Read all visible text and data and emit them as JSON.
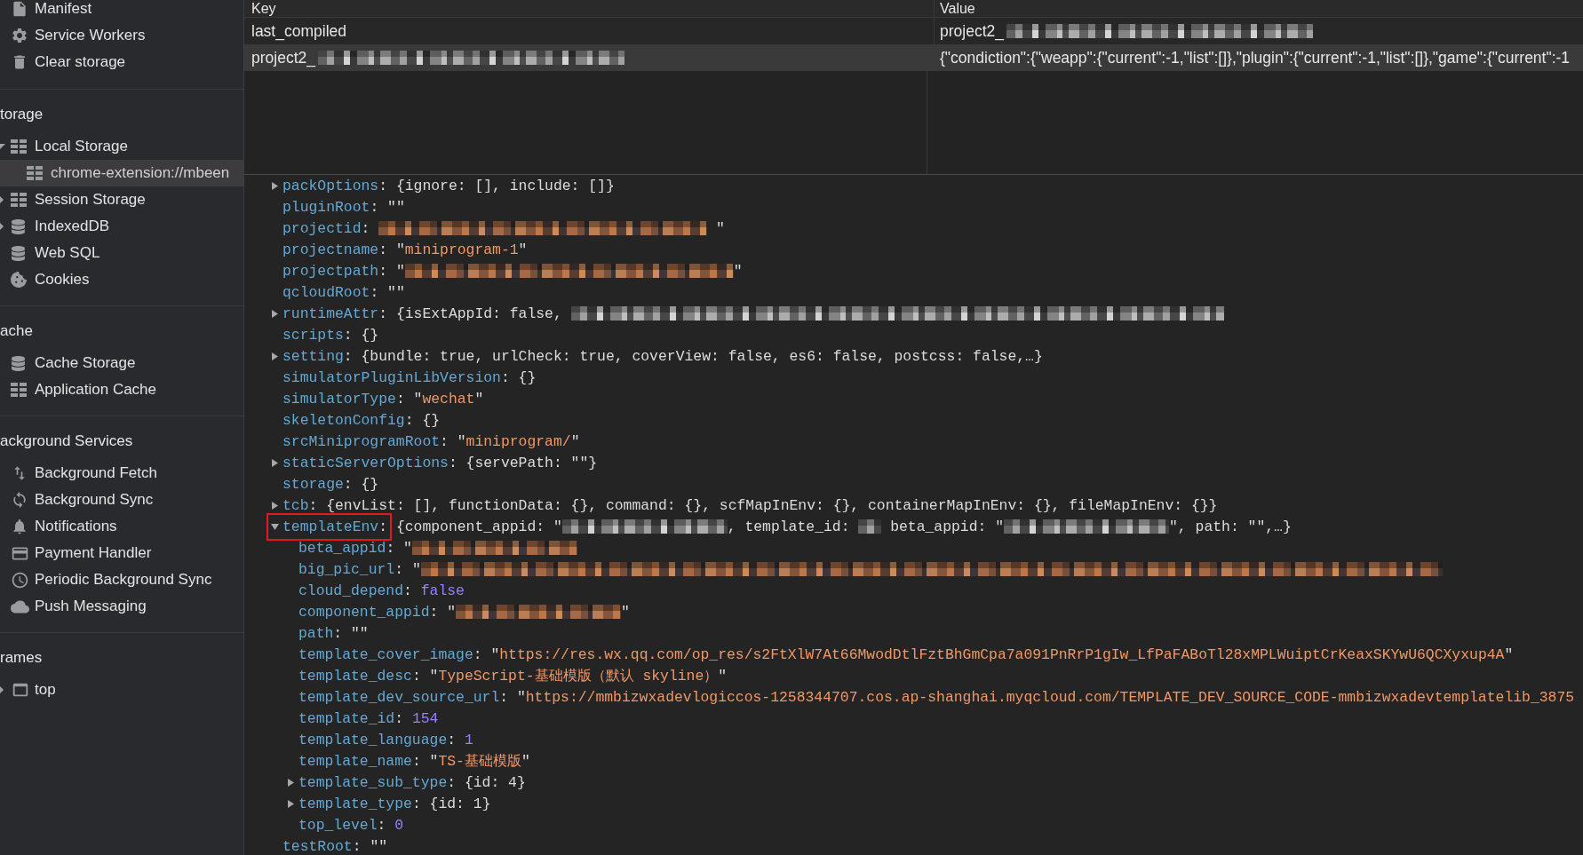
{
  "sidebar": {
    "sections": [
      {
        "items": [
          {
            "label": "Manifest",
            "kind": "file",
            "selected": false
          },
          {
            "label": "Service Workers",
            "kind": "worker",
            "selected": false
          },
          {
            "label": "Clear storage",
            "kind": "clear",
            "selected": false
          }
        ]
      },
      {
        "title": "torage",
        "items": [
          {
            "label": "Local Storage",
            "kind": "key-value",
            "selected": false,
            "expanded": true,
            "children": [
              {
                "label": "chrome-extension://mbeen",
                "kind": "key-value",
                "selected": true
              }
            ]
          },
          {
            "label": "Session Storage",
            "kind": "key-value",
            "selected": false,
            "expanded": false
          },
          {
            "label": "IndexedDB",
            "kind": "database",
            "selected": false,
            "expanded": false
          },
          {
            "label": "Web SQL",
            "kind": "database",
            "selected": false
          },
          {
            "label": "Cookies",
            "kind": "cookies",
            "selected": false
          }
        ]
      },
      {
        "title": "ache",
        "items": [
          {
            "label": "Cache Storage",
            "kind": "database",
            "selected": false
          },
          {
            "label": "Application Cache",
            "kind": "key-value",
            "selected": false
          }
        ]
      },
      {
        "title": "ackground Services",
        "items": [
          {
            "label": "Background Fetch",
            "kind": "fetch",
            "selected": false
          },
          {
            "label": "Background Sync",
            "kind": "sync",
            "selected": false
          },
          {
            "label": "Notifications",
            "kind": "notifications",
            "selected": false
          },
          {
            "label": "Payment Handler",
            "kind": "payment",
            "selected": false
          },
          {
            "label": "Periodic Background Sync",
            "kind": "periodic-sync",
            "selected": false
          },
          {
            "label": "Push Messaging",
            "kind": "push",
            "selected": false
          }
        ]
      },
      {
        "title": "rames",
        "items": [
          {
            "label": "top",
            "kind": "frame",
            "selected": false,
            "expanded": false
          }
        ]
      }
    ]
  },
  "storage_table": {
    "columns": [
      "Key",
      "Value"
    ],
    "rows": [
      {
        "selected": false,
        "key": [
          {
            "kind": "text",
            "text": "last_compiled"
          }
        ],
        "value": [
          {
            "kind": "text",
            "text": "project2_"
          },
          {
            "kind": "plain-mosaic-medium"
          }
        ]
      },
      {
        "selected": true,
        "key": [
          {
            "kind": "text",
            "text": "project2_"
          },
          {
            "kind": "plain-mosaic-medium"
          }
        ],
        "value": [
          {
            "kind": "text",
            "text": "{\"condiction\":{\"weapp\":{\"current\":-1,\"list\":[]},\"plugin\":{\"current\":-1,\"list\":[]},\"game\":{\"current\":-1"
          }
        ]
      }
    ]
  },
  "object_preview": {
    "lines": [
      {
        "key": "packOptions",
        "separator": ":",
        "expanded": false,
        "value": [
          {
            "kind": "plain",
            "text": "{ignore: [], include: []}"
          }
        ]
      },
      {
        "key": "pluginRoot",
        "separator": ":",
        "value": [
          {
            "kind": "plain",
            "text": "\"\""
          }
        ]
      },
      {
        "key": "projectid",
        "separator": ":",
        "value": [
          {
            "kind": "string-mosaic-medium"
          },
          {
            "kind": "plain",
            "text": " \""
          }
        ]
      },
      {
        "key": "projectname",
        "separator": ":",
        "value": [
          {
            "kind": "plain",
            "text": "\""
          },
          {
            "kind": "string",
            "text": "miniprogram-1"
          },
          {
            "kind": "plain",
            "text": "\""
          }
        ]
      },
      {
        "key": "projectpath",
        "separator": ":",
        "value": [
          {
            "kind": "plain",
            "text": "\""
          },
          {
            "kind": "string-mosaic-medium"
          },
          {
            "kind": "plain",
            "text": "\""
          }
        ]
      },
      {
        "key": "qcloudRoot",
        "separator": ":",
        "value": [
          {
            "kind": "plain",
            "text": "\"\""
          }
        ]
      },
      {
        "key": "runtimeAttr",
        "separator": ":",
        "expanded": false,
        "value": [
          {
            "kind": "plain",
            "text": "{isExtAppId: false, "
          },
          {
            "kind": "plain-mosaic-long"
          }
        ]
      },
      {
        "key": "scripts",
        "separator": ":",
        "value": [
          {
            "kind": "plain",
            "text": "{}"
          }
        ]
      },
      {
        "key": "setting",
        "separator": ":",
        "expanded": false,
        "value": [
          {
            "kind": "plain",
            "text": "{bundle: true, urlCheck: true, coverView: false, es6: false, postcss: false,…}"
          }
        ]
      },
      {
        "key": "simulatorPluginLibVersion",
        "separator": ":",
        "value": [
          {
            "kind": "plain",
            "text": "{}"
          }
        ]
      },
      {
        "key": "simulatorType",
        "separator": ":",
        "value": [
          {
            "kind": "plain",
            "text": "\""
          },
          {
            "kind": "string",
            "text": "wechat"
          },
          {
            "kind": "plain",
            "text": "\""
          }
        ]
      },
      {
        "key": "skeletonConfig",
        "separator": ":",
        "value": [
          {
            "kind": "plain",
            "text": "{}"
          }
        ]
      },
      {
        "key": "srcMiniprogramRoot",
        "separator": ":",
        "value": [
          {
            "kind": "plain",
            "text": "\""
          },
          {
            "kind": "string",
            "text": "miniprogram/"
          },
          {
            "kind": "plain",
            "text": "\""
          }
        ]
      },
      {
        "key": "staticServerOptions",
        "separator": ":",
        "expanded": false,
        "value": [
          {
            "kind": "plain",
            "text": "{servePath: \"\"}"
          }
        ]
      },
      {
        "key": "storage",
        "separator": ":",
        "value": [
          {
            "kind": "plain",
            "text": "{}"
          }
        ]
      },
      {
        "key": "tcb",
        "separator": ":",
        "expanded": false,
        "value": [
          {
            "kind": "plain",
            "text": "{envList: [], functionData: {}, command: {}, scfMapInEnv: {}, containerMapInEnv: {}, fileMapInEnv: {}}"
          }
        ]
      },
      {
        "key": "templateEnv",
        "separator": ":",
        "expanded": true,
        "highlighted": true,
        "value": [
          {
            "kind": "plain",
            "text": "{component_appid: \""
          },
          {
            "kind": "plain-mosaic-short"
          },
          {
            "kind": "plain",
            "text": ", template_id: "
          },
          {
            "kind": "plain-mosaic-tiny"
          },
          {
            "kind": "plain",
            "text": " beta_appid: \""
          },
          {
            "kind": "plain-mosaic-short"
          },
          {
            "kind": "plain",
            "text": "\", path: \"\",…}"
          }
        ],
        "children": [
          {
            "key": "beta_appid",
            "separator": ":",
            "value": [
              {
                "kind": "plain",
                "text": "\""
              },
              {
                "kind": "string-mosaic-short"
              }
            ]
          },
          {
            "key": "big_pic_url",
            "separator": ":",
            "value": [
              {
                "kind": "plain",
                "text": "\""
              },
              {
                "kind": "string-mosaic-xlong"
              }
            ]
          },
          {
            "key": "cloud_depend",
            "separator": ":",
            "value": [
              {
                "kind": "number",
                "text": "false"
              }
            ]
          },
          {
            "key": "component_appid",
            "separator": ":",
            "value": [
              {
                "kind": "plain",
                "text": "\""
              },
              {
                "kind": "string-mosaic-short"
              },
              {
                "kind": "plain",
                "text": "\""
              }
            ]
          },
          {
            "key": "path",
            "separator": ":",
            "value": [
              {
                "kind": "plain",
                "text": "\"\""
              }
            ]
          },
          {
            "key": "template_cover_image",
            "separator": ":",
            "value": [
              {
                "kind": "plain",
                "text": "\""
              },
              {
                "kind": "string",
                "text": "https://res.wx.qq.com/op_res/s2FtXlW7At66MwodDtlFztBhGmCpa7a091PnRrP1gIw_LfPaFABoTl28xMPLWuiptCrKeaxSKYwU6QCXyxup4A"
              },
              {
                "kind": "plain",
                "text": "\""
              }
            ]
          },
          {
            "key": "template_desc",
            "separator": ":",
            "value": [
              {
                "kind": "plain",
                "text": "\""
              },
              {
                "kind": "string",
                "text": "TypeScript-基础模版（默认 skyline）"
              },
              {
                "kind": "plain",
                "text": "\""
              }
            ]
          },
          {
            "key": "template_dev_source_url",
            "separator": ":",
            "value": [
              {
                "kind": "plain",
                "text": "\""
              },
              {
                "kind": "string",
                "text": "https://mmbizwxadevlogiccos-1258344707.cos.ap-shanghai.myqcloud.com/TEMPLATE_DEV_SOURCE_CODE-mmbizwxadevtemplatelib_3875"
              }
            ]
          },
          {
            "key": "template_id",
            "separator": ":",
            "value": [
              {
                "kind": "number",
                "text": "154"
              }
            ]
          },
          {
            "key": "template_language",
            "separator": ":",
            "value": [
              {
                "kind": "number",
                "text": "1"
              }
            ]
          },
          {
            "key": "template_name",
            "separator": ":",
            "value": [
              {
                "kind": "plain",
                "text": "\""
              },
              {
                "kind": "string",
                "text": "TS-基础模版"
              },
              {
                "kind": "plain",
                "text": "\""
              }
            ]
          },
          {
            "key": "template_sub_type",
            "separator": ":",
            "expanded": false,
            "value": [
              {
                "kind": "plain",
                "text": "{id: 4}"
              }
            ]
          },
          {
            "key": "template_type",
            "separator": ":",
            "expanded": false,
            "value": [
              {
                "kind": "plain",
                "text": "{id: 1}"
              }
            ]
          },
          {
            "key": "top_level",
            "separator": ":",
            "value": [
              {
                "kind": "number",
                "text": "0"
              }
            ]
          }
        ]
      },
      {
        "key": "testRoot",
        "separator": ":",
        "value": [
          {
            "kind": "plain",
            "text": "\"\""
          }
        ]
      }
    ]
  }
}
